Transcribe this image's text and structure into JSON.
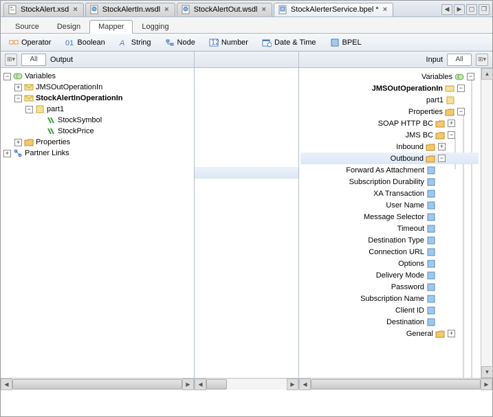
{
  "tabs": [
    {
      "label": "StockAlert.xsd"
    },
    {
      "label": "StockAlertIn.wsdl"
    },
    {
      "label": "StockAlertOut.wsdl"
    },
    {
      "label": "StockAlerterService.bpel *",
      "selected": true
    }
  ],
  "views": {
    "source": "Source",
    "design": "Design",
    "mapper": "Mapper",
    "logging": "Logging"
  },
  "toolbar": {
    "operator": "Operator",
    "boolean": "Boolean",
    "string": "String",
    "node": "Node",
    "number": "Number",
    "dateTime": "Date & Time",
    "bpel": "BPEL"
  },
  "filter": {
    "left_all": "All",
    "left_output": "Output",
    "right_input": "Input",
    "right_all": "All"
  },
  "leftTree": {
    "variables": "Variables",
    "jmsOut": "JMSOutOperationIn",
    "stockAlertIn": "StockAlertInOperationIn",
    "part1": "part1",
    "stockSymbol": "StockSymbol",
    "stockPrice": "StockPrice",
    "properties": "Properties",
    "partnerLinks": "Partner Links"
  },
  "rightTree": {
    "variables": "Variables",
    "jmsOut": "JMSOutOperationIn",
    "part1": "part1",
    "properties": "Properties",
    "soapHttp": "SOAP HTTP BC",
    "jmsBc": "JMS BC",
    "inbound": "Inbound",
    "outbound": "Outbound",
    "forwardAsAttachment": "Forward As Attachment",
    "subscriptionDurability": "Subscription Durability",
    "xaTransaction": "XA Transaction",
    "userName": "User Name",
    "messageSelector": "Message Selector",
    "timeout": "Timeout",
    "destinationType": "Destination Type",
    "connectionUrl": "Connection URL",
    "options": "Options",
    "deliveryMode": "Delivery Mode",
    "password": "Password",
    "subscriptionName": "Subscription Name",
    "clientId": "Client ID",
    "destination": "Destination",
    "general": "General"
  }
}
